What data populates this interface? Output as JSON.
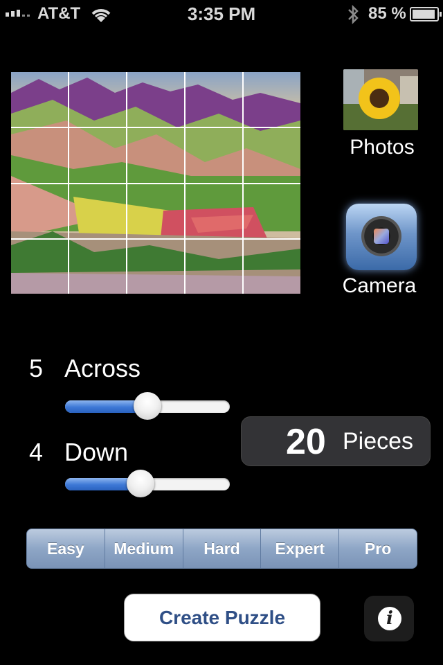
{
  "status_bar": {
    "carrier": "AT&T",
    "time": "3:35 PM",
    "battery_percent": "85 %"
  },
  "media": {
    "photos_label": "Photos",
    "camera_label": "Camera"
  },
  "settings": {
    "across_value": "5",
    "across_label": "Across",
    "across_level": 0.5,
    "down_value": "4",
    "down_label": "Down",
    "down_level": 0.45
  },
  "pieces": {
    "count": "20",
    "label": "Pieces"
  },
  "difficulty": {
    "options": [
      "Easy",
      "Medium",
      "Hard",
      "Expert",
      "Pro"
    ]
  },
  "actions": {
    "create_label": "Create Puzzle",
    "info_icon": "i"
  },
  "colors": {
    "slider_fill": "#3d78d6",
    "segment_bg": "#8ea6c6",
    "create_text": "#2f4f86"
  }
}
